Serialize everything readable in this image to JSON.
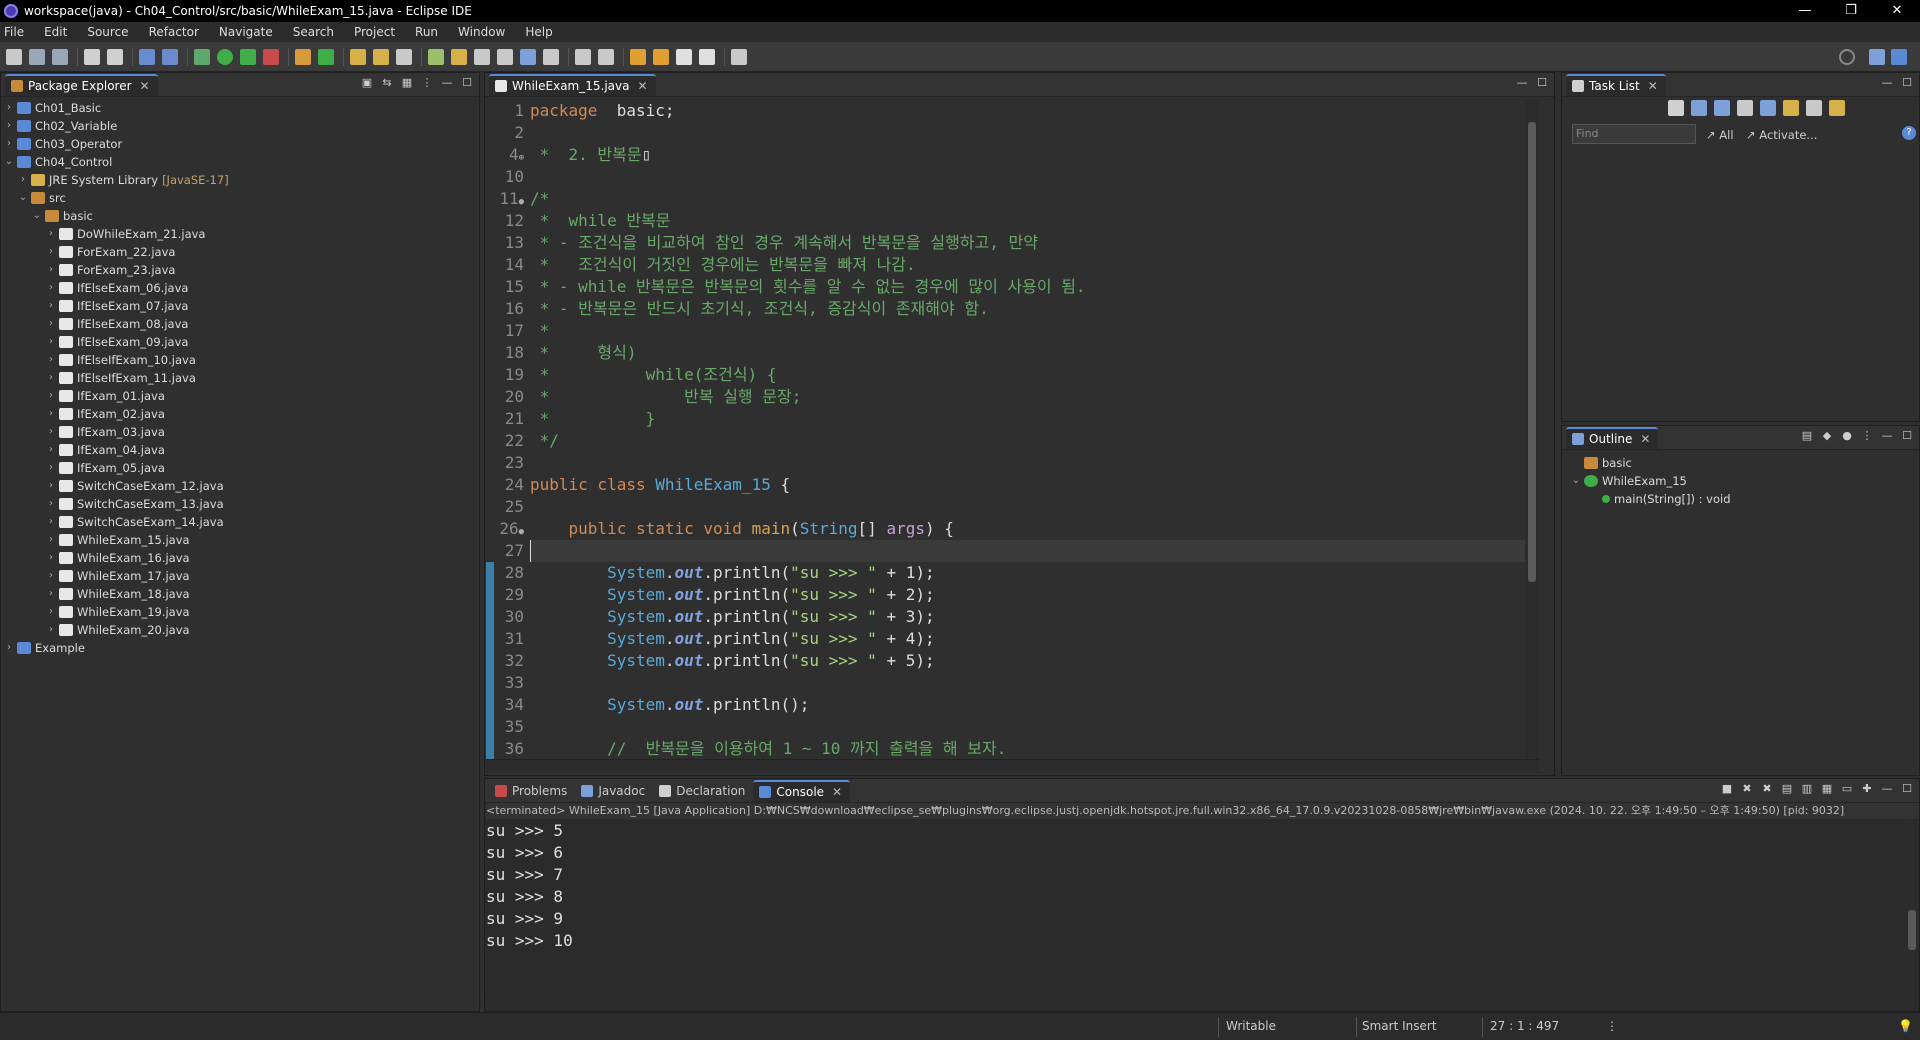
{
  "window": {
    "title": "workspace(java) - Ch04_Control/src/basic/WhileExam_15.java - Eclipse IDE",
    "buttons": [
      "—",
      "❐",
      "✕"
    ]
  },
  "menu": [
    "File",
    "Edit",
    "Source",
    "Refactor",
    "Navigate",
    "Search",
    "Project",
    "Run",
    "Window",
    "Help"
  ],
  "package_explorer": {
    "tab": "Package Explorer",
    "items": [
      {
        "label": "Ch01_Basic",
        "depth": 0,
        "arrow": "›",
        "icon": "project"
      },
      {
        "label": "Ch02_Variable",
        "depth": 0,
        "arrow": "›",
        "icon": "project"
      },
      {
        "label": "Ch03_Operator",
        "depth": 0,
        "arrow": "›",
        "icon": "project"
      },
      {
        "label": "Ch04_Control",
        "depth": 0,
        "arrow": "⌄",
        "icon": "project"
      },
      {
        "label": "JRE System Library",
        "decoration": "[JavaSE-17]",
        "depth": 1,
        "arrow": "›",
        "icon": "library"
      },
      {
        "label": "src",
        "depth": 1,
        "arrow": "⌄",
        "icon": "folder"
      },
      {
        "label": "basic",
        "depth": 2,
        "arrow": "⌄",
        "icon": "package"
      },
      {
        "label": "DoWhileExam_21.java",
        "depth": 3,
        "arrow": "›",
        "icon": "file"
      },
      {
        "label": "ForExam_22.java",
        "depth": 3,
        "arrow": "›",
        "icon": "file"
      },
      {
        "label": "ForExam_23.java",
        "depth": 3,
        "arrow": "›",
        "icon": "file"
      },
      {
        "label": "IfElseExam_06.java",
        "depth": 3,
        "arrow": "›",
        "icon": "file"
      },
      {
        "label": "IfElseExam_07.java",
        "depth": 3,
        "arrow": "›",
        "icon": "file"
      },
      {
        "label": "IfElseExam_08.java",
        "depth": 3,
        "arrow": "›",
        "icon": "file"
      },
      {
        "label": "IfElseExam_09.java",
        "depth": 3,
        "arrow": "›",
        "icon": "file"
      },
      {
        "label": "IfElseIfExam_10.java",
        "depth": 3,
        "arrow": "›",
        "icon": "file"
      },
      {
        "label": "IfElseIfExam_11.java",
        "depth": 3,
        "arrow": "›",
        "icon": "file"
      },
      {
        "label": "IfExam_01.java",
        "depth": 3,
        "arrow": "›",
        "icon": "file"
      },
      {
        "label": "IfExam_02.java",
        "depth": 3,
        "arrow": "›",
        "icon": "file"
      },
      {
        "label": "IfExam_03.java",
        "depth": 3,
        "arrow": "›",
        "icon": "file"
      },
      {
        "label": "IfExam_04.java",
        "depth": 3,
        "arrow": "›",
        "icon": "file"
      },
      {
        "label": "IfExam_05.java",
        "depth": 3,
        "arrow": "›",
        "icon": "file"
      },
      {
        "label": "SwitchCaseExam_12.java",
        "depth": 3,
        "arrow": "›",
        "icon": "file"
      },
      {
        "label": "SwitchCaseExam_13.java",
        "depth": 3,
        "arrow": "›",
        "icon": "file"
      },
      {
        "label": "SwitchCaseExam_14.java",
        "depth": 3,
        "arrow": "›",
        "icon": "file"
      },
      {
        "label": "WhileExam_15.java",
        "depth": 3,
        "arrow": "›",
        "icon": "file"
      },
      {
        "label": "WhileExam_16.java",
        "depth": 3,
        "arrow": "›",
        "icon": "file"
      },
      {
        "label": "WhileExam_17.java",
        "depth": 3,
        "arrow": "›",
        "icon": "file"
      },
      {
        "label": "WhileExam_18.java",
        "depth": 3,
        "arrow": "›",
        "icon": "file"
      },
      {
        "label": "WhileExam_19.java",
        "depth": 3,
        "arrow": "›",
        "icon": "file"
      },
      {
        "label": "WhileExam_20.java",
        "depth": 3,
        "arrow": "›",
        "icon": "file"
      },
      {
        "label": "Example",
        "depth": 0,
        "arrow": "›",
        "icon": "project"
      }
    ]
  },
  "editor": {
    "tab": "WhileExam_15.java",
    "lines": [
      {
        "n": "1",
        "code": [
          [
            "kw",
            "package"
          ],
          [
            "",
            "  basic;"
          ]
        ]
      },
      {
        "n": "2",
        "code": []
      },
      {
        "n": "4",
        "marker": "⊕",
        "code": [
          [
            "com",
            " *  2. 반복문"
          ],
          [
            "",
            "▯"
          ]
        ]
      },
      {
        "n": "10",
        "code": []
      },
      {
        "n": "11",
        "marker": "●",
        "code": [
          [
            "com",
            "/*"
          ]
        ]
      },
      {
        "n": "12",
        "code": [
          [
            "com",
            " *  while 반복문"
          ]
        ]
      },
      {
        "n": "13",
        "code": [
          [
            "com",
            " * - 조건식을 비교하여 참인 경우 계속해서 반복문을 실행하고, 만약"
          ]
        ]
      },
      {
        "n": "14",
        "code": [
          [
            "com",
            " *   조건식이 거짓인 경우에는 반복문을 빠져 나감."
          ]
        ]
      },
      {
        "n": "15",
        "code": [
          [
            "com",
            " * - while 반복문은 반복문의 횟수를 알 수 없는 경우에 많이 사용이 됨."
          ]
        ]
      },
      {
        "n": "16",
        "code": [
          [
            "com",
            " * - 반복문은 반드시 초기식, 조건식, 증감식이 존재해야 함."
          ]
        ]
      },
      {
        "n": "17",
        "code": [
          [
            "com",
            " *"
          ]
        ]
      },
      {
        "n": "18",
        "code": [
          [
            "com",
            " *     형식)"
          ]
        ]
      },
      {
        "n": "19",
        "code": [
          [
            "com",
            " *          while(조건식) {"
          ]
        ]
      },
      {
        "n": "20",
        "code": [
          [
            "com",
            " *              반복 실행 문장;"
          ]
        ]
      },
      {
        "n": "21",
        "code": [
          [
            "com",
            " *          }"
          ]
        ]
      },
      {
        "n": "22",
        "code": [
          [
            "com",
            " */"
          ]
        ]
      },
      {
        "n": "23",
        "code": []
      },
      {
        "n": "24",
        "code": [
          [
            "kw",
            "public class "
          ],
          [
            "cls",
            "WhileExam_15"
          ],
          [
            "",
            " {"
          ]
        ]
      },
      {
        "n": "25",
        "code": []
      },
      {
        "n": "26",
        "marker": "●",
        "code": [
          [
            "",
            "    "
          ],
          [
            "kw",
            "public static void "
          ],
          [
            "mth",
            "main"
          ],
          [
            "",
            "("
          ],
          [
            "cls",
            "String"
          ],
          [
            "",
            "[] "
          ],
          [
            "prm",
            "args"
          ],
          [
            "",
            ") {"
          ]
        ]
      },
      {
        "n": "27",
        "code": []
      },
      {
        "n": "28",
        "code": [
          [
            "",
            "        "
          ],
          [
            "cls",
            "System"
          ],
          [
            "",
            "."
          ],
          [
            "fld",
            "out"
          ],
          [
            "",
            ".println("
          ],
          [
            "str",
            "\"su >>> \""
          ],
          [
            "",
            " + 1);"
          ]
        ]
      },
      {
        "n": "29",
        "code": [
          [
            "",
            "        "
          ],
          [
            "cls",
            "System"
          ],
          [
            "",
            "."
          ],
          [
            "fld",
            "out"
          ],
          [
            "",
            ".println("
          ],
          [
            "str",
            "\"su >>> \""
          ],
          [
            "",
            " + 2);"
          ]
        ]
      },
      {
        "n": "30",
        "code": [
          [
            "",
            "        "
          ],
          [
            "cls",
            "System"
          ],
          [
            "",
            "."
          ],
          [
            "fld",
            "out"
          ],
          [
            "",
            ".println("
          ],
          [
            "str",
            "\"su >>> \""
          ],
          [
            "",
            " + 3);"
          ]
        ]
      },
      {
        "n": "31",
        "code": [
          [
            "",
            "        "
          ],
          [
            "cls",
            "System"
          ],
          [
            "",
            "."
          ],
          [
            "fld",
            "out"
          ],
          [
            "",
            ".println("
          ],
          [
            "str",
            "\"su >>> \""
          ],
          [
            "",
            " + 4);"
          ]
        ]
      },
      {
        "n": "32",
        "code": [
          [
            "",
            "        "
          ],
          [
            "cls",
            "System"
          ],
          [
            "",
            "."
          ],
          [
            "fld",
            "out"
          ],
          [
            "",
            ".println("
          ],
          [
            "str",
            "\"su >>> \""
          ],
          [
            "",
            " + 5);"
          ]
        ]
      },
      {
        "n": "33",
        "code": []
      },
      {
        "n": "34",
        "code": [
          [
            "",
            "        "
          ],
          [
            "cls",
            "System"
          ],
          [
            "",
            "."
          ],
          [
            "fld",
            "out"
          ],
          [
            "",
            ".println();"
          ]
        ]
      },
      {
        "n": "35",
        "code": []
      },
      {
        "n": "36",
        "code": [
          [
            "com",
            "        //  반복문을 이용하여 1 ~ 10 까지 출력을 해 보자."
          ]
        ]
      }
    ]
  },
  "tasklist": {
    "tab": "Task List",
    "find_placeholder": "Find",
    "all": "All",
    "activate": "Activate..."
  },
  "outline": {
    "tab": "Outline",
    "items": [
      "basic",
      "WhileExam_15",
      "main(String[]) : void"
    ]
  },
  "bottom": {
    "tabs": [
      "Problems",
      "Javadoc",
      "Declaration",
      "Console"
    ],
    "terminated": "<terminated> WhileExam_15 [Java Application] D:₩NCS₩download₩eclipse_se₩plugins₩org.eclipse.justj.openjdk.hotspot.jre.full.win32.x86_64_17.0.9.v20231028-0858₩jre₩bin₩javaw.exe  (2024. 10. 22. 오후 1:49:50 – 오후 1:49:50) [pid: 9032]",
    "output": [
      "su >>> 5",
      "su >>> 6",
      "su >>> 7",
      "su >>> 8",
      "su >>> 9",
      "su >>> 10"
    ]
  },
  "status": {
    "writable": "Writable",
    "insert": "Smart Insert",
    "position": "27 : 1 : 497"
  },
  "colors": {
    "accent": "#5a8ad6",
    "keyword": "#d28a55",
    "string": "#a8d37f",
    "comment": "#6aa86a",
    "class": "#5aa9d8"
  }
}
